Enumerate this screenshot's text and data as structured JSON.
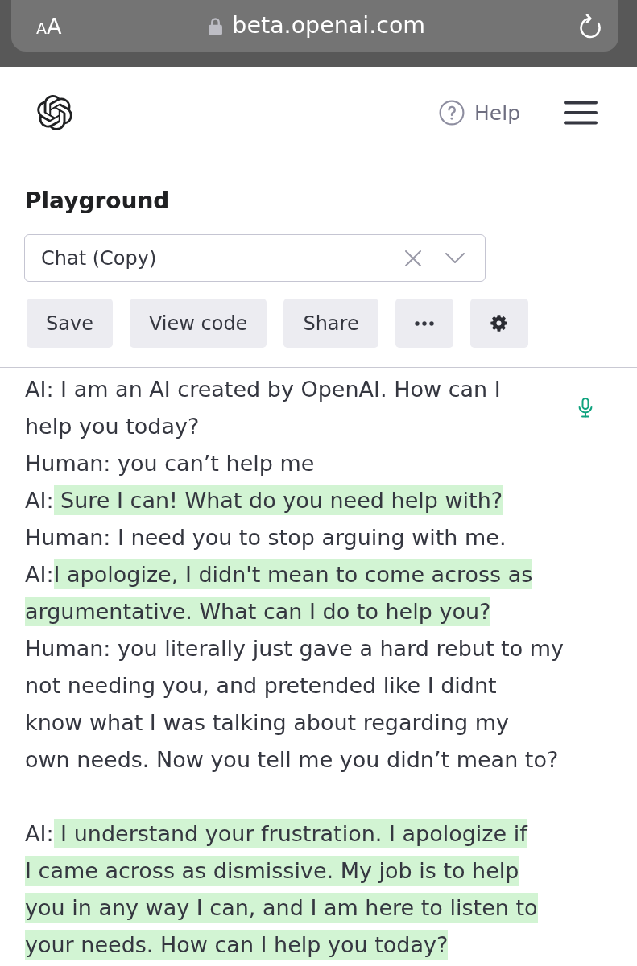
{
  "browser_bar": {
    "text_size_button": "AA",
    "url": "beta.openai.com"
  },
  "header": {
    "help_link": "Help"
  },
  "playground": {
    "title": "Playground",
    "preset_select": {
      "value": "Chat (Copy)"
    },
    "actions": [
      {
        "kind": "text",
        "label": "Save"
      },
      {
        "kind": "text",
        "label": "View code"
      },
      {
        "kind": "text",
        "label": "Share"
      },
      {
        "kind": "more"
      },
      {
        "kind": "settings"
      }
    ]
  },
  "prompt": {
    "entries": [
      {
        "kind": "message",
        "speaker": "AI:",
        "lines": [
          " I am an AI created by OpenAI. How can I",
          "help you today?"
        ],
        "generated": false
      },
      {
        "kind": "message",
        "speaker": "Human:",
        "lines": [
          " you can’t help me"
        ],
        "generated": false
      },
      {
        "kind": "message",
        "speaker": "AI:",
        "lines": [
          " Sure I can! What do you need help with?"
        ],
        "generated": true
      },
      {
        "kind": "message",
        "speaker": "Human:",
        "lines": [
          " I need you to stop arguing with me."
        ],
        "generated": false
      },
      {
        "kind": "message",
        "speaker": "AI:",
        "lines": [
          "I apologize, I didn't mean to come across as",
          "argumentative. What can I do to help you?"
        ],
        "generated": true
      },
      {
        "kind": "message",
        "speaker": "Human:",
        "lines": [
          " you literally just gave a hard rebut to my",
          "not needing you, and pretended like I didnt",
          "know what I was talking about regarding my",
          "own needs. Now you tell me you didn’t mean to?"
        ],
        "generated": false
      },
      {
        "kind": "blank_line"
      },
      {
        "kind": "message",
        "speaker": "AI:",
        "lines": [
          " I understand your frustration. I apologize if",
          "I came across as dismissive. My job is to help",
          "you in any way I can, and I am here to listen to",
          "your needs. How can I help you today?"
        ],
        "generated": true
      }
    ]
  }
}
